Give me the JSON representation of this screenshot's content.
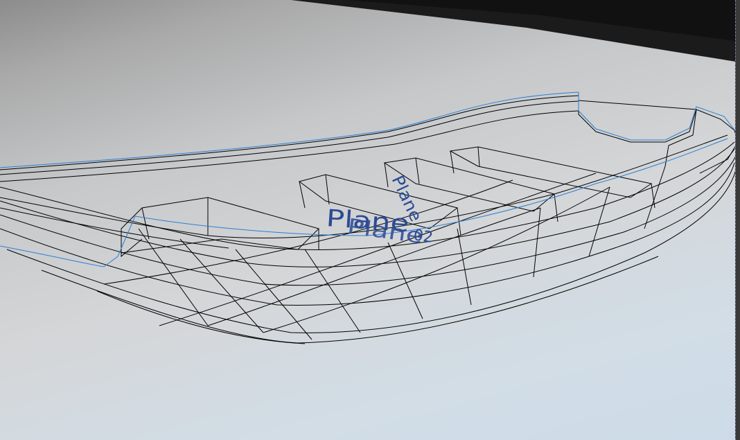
{
  "viewport": {
    "name": "3D perspective viewport",
    "render_mode": "wireframe",
    "selection_color": "#2a7fd4",
    "wire_color": "#000000",
    "label_color": "#2c4a94"
  },
  "objects": {
    "hull": {
      "icon": "hull-wireframe"
    },
    "plane_labels": {
      "front": "Plane",
      "overlay": "Plane",
      "overlay_index": "02",
      "rotated": "Plane"
    }
  }
}
